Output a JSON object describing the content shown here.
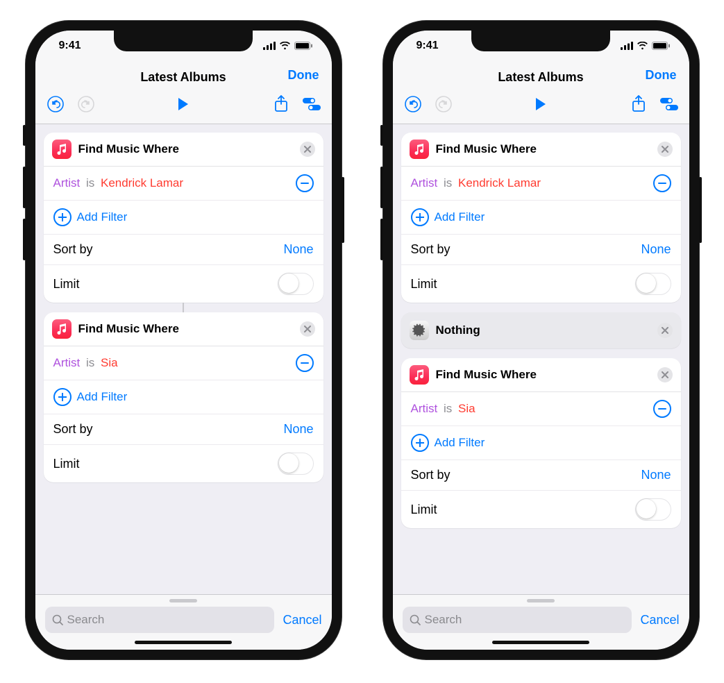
{
  "status": {
    "time": "9:41"
  },
  "nav": {
    "title": "Latest Albums",
    "done": "Done"
  },
  "labels": {
    "add_filter": "Add Filter",
    "sort_by": "Sort by",
    "none": "None",
    "limit": "Limit",
    "search_placeholder": "Search",
    "cancel": "Cancel"
  },
  "phones": [
    {
      "cards": [
        {
          "type": "find",
          "title": "Find Music Where",
          "filter": {
            "field": "Artist",
            "op": "is",
            "value": "Kendrick Lamar"
          }
        },
        {
          "type": "find",
          "title": "Find Music Where",
          "filter": {
            "field": "Artist",
            "op": "is",
            "value": "Sia"
          }
        }
      ]
    },
    {
      "cards": [
        {
          "type": "find",
          "title": "Find Music Where",
          "filter": {
            "field": "Artist",
            "op": "is",
            "value": "Kendrick Lamar"
          }
        },
        {
          "type": "nothing",
          "title": "Nothing"
        },
        {
          "type": "find",
          "title": "Find Music Where",
          "filter": {
            "field": "Artist",
            "op": "is",
            "value": "Sia"
          }
        }
      ]
    }
  ]
}
